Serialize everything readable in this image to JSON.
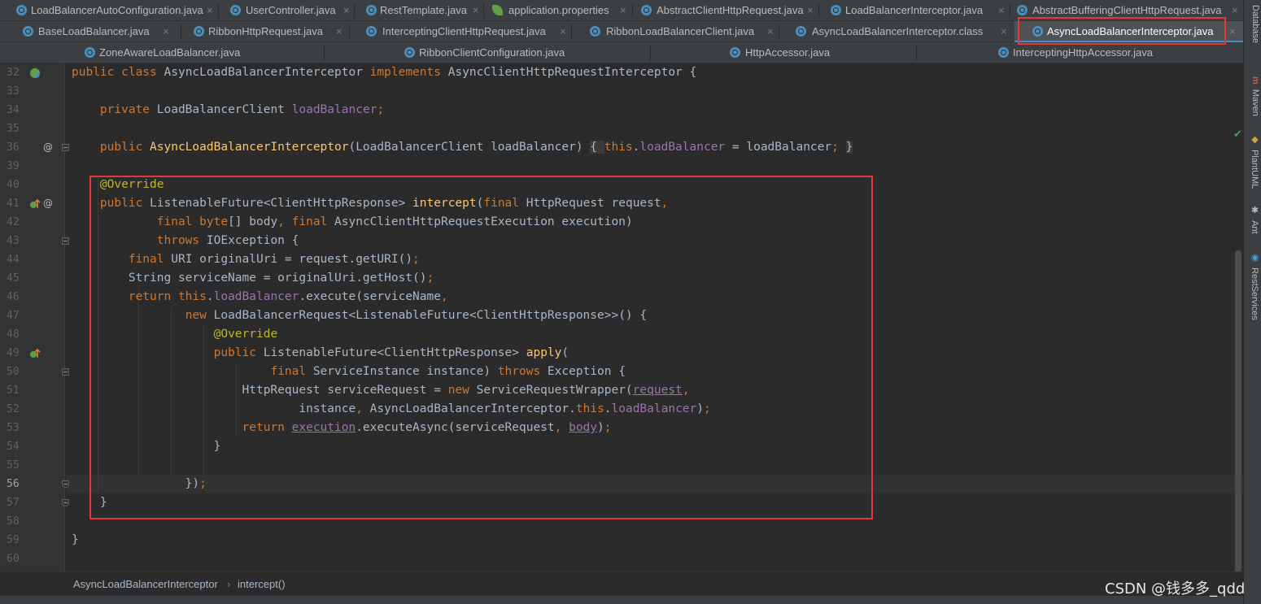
{
  "tabs": {
    "row1": [
      {
        "label": "LoadBalancerAutoConfiguration.java",
        "icon": "class-icon"
      },
      {
        "label": "UserController.java",
        "icon": "class-icon"
      },
      {
        "label": "RestTemplate.java",
        "icon": "class-icon"
      },
      {
        "label": "application.properties",
        "icon": "spring-leaf-icon"
      },
      {
        "label": "AbstractClientHttpRequest.java",
        "icon": "class-icon"
      },
      {
        "label": "LoadBalancerInterceptor.java",
        "icon": "class-icon"
      },
      {
        "label": "AbstractBufferingClientHttpRequest.java",
        "icon": "class-icon"
      }
    ],
    "row2": [
      {
        "label": "BaseLoadBalancer.java",
        "icon": "class-icon"
      },
      {
        "label": "RibbonHttpRequest.java",
        "icon": "class-icon"
      },
      {
        "label": "InterceptingClientHttpRequest.java",
        "icon": "class-icon"
      },
      {
        "label": "RibbonLoadBalancerClient.java",
        "icon": "class-icon"
      },
      {
        "label": "AsyncLoadBalancerInterceptor.class",
        "icon": "class-icon"
      },
      {
        "label": "AsyncLoadBalancerInterceptor.java",
        "icon": "class-icon",
        "active": true
      }
    ],
    "row3": [
      {
        "label": "ZoneAwareLoadBalancer.java",
        "icon": "class-icon"
      },
      {
        "label": "RibbonClientConfiguration.java",
        "icon": "class-icon"
      },
      {
        "label": "HttpAccessor.java",
        "icon": "class-icon"
      },
      {
        "label": "InterceptingHttpAccessor.java",
        "icon": "class-icon"
      }
    ],
    "close_glyph": "×"
  },
  "editor": {
    "line_numbers": [
      "32",
      "33",
      "34",
      "35",
      "36",
      "39",
      "40",
      "41",
      "42",
      "43",
      "44",
      "45",
      "46",
      "47",
      "48",
      "49",
      "50",
      "51",
      "52",
      "53",
      "54",
      "55",
      "56",
      "57",
      "58",
      "59",
      "60"
    ],
    "current_line": "56",
    "gutter_marks": {
      "at": "@",
      "override_up": "↑"
    }
  },
  "tool_windows": [
    "Database",
    "Maven",
    "PlantUML",
    "Ant",
    "RestServices"
  ],
  "breadcrumb": {
    "class_name": "AsyncLoadBalancerInterceptor",
    "separator": "›",
    "method": "intercept()"
  },
  "watermark": "CSDN @钱多多_qdd",
  "colors": {
    "keyword": "#cc7832",
    "function": "#ffc66d",
    "field": "#9876aa",
    "annotation": "#bbb529",
    "text": "#a9b7c6",
    "highlight_box": "#e2393b",
    "active_tab": "#4a88c7"
  }
}
